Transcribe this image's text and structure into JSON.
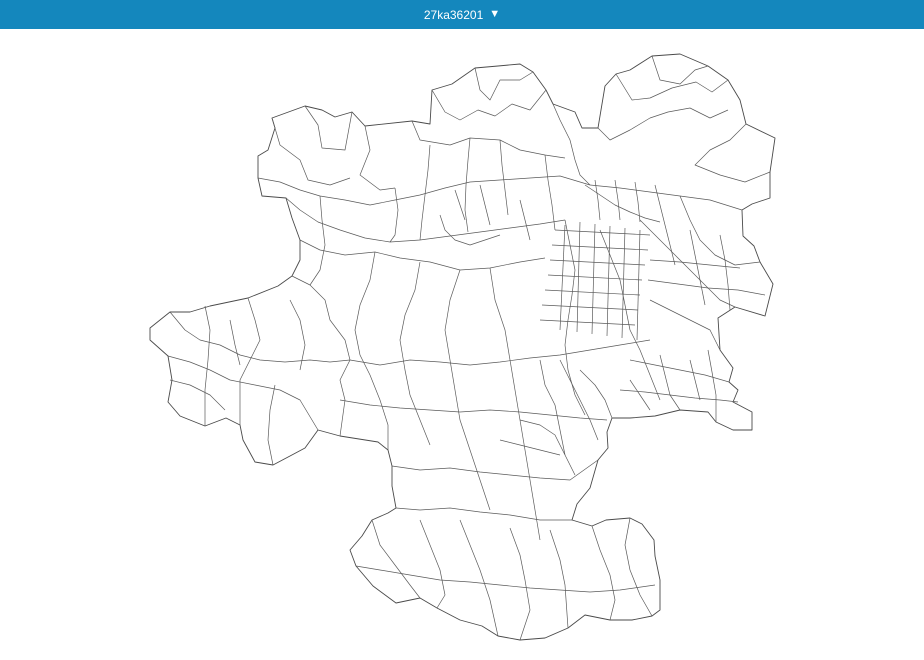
{
  "header": {
    "title": "27ka36201",
    "dropdown_icon": "triangle-down-icon"
  },
  "colors": {
    "header_background": "#1487bd",
    "header_text": "#ffffff",
    "boundary_line": "#5a5a5a",
    "map_background": "#ffffff"
  }
}
